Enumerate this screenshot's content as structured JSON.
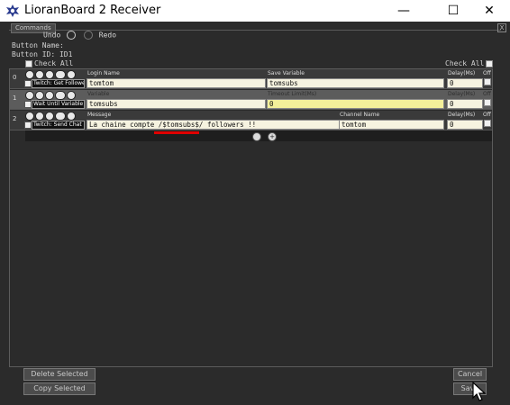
{
  "window": {
    "title": "LioranBoard 2 Receiver",
    "minimize_glyph": "—",
    "maximize_glyph": "☐",
    "close_glyph": "✕",
    "app_icon": "lioranboard-logo-icon"
  },
  "panel": {
    "tab_label": "Commands",
    "close_glyph": "X",
    "undo_label": "Undo",
    "redo_label": "Redo",
    "button_name_line": "Button Name:",
    "button_id_line": "Button ID: ID1",
    "check_all_label": "Check All"
  },
  "rows": [
    {
      "index": "0",
      "command": "Twitch: Get Follower",
      "field1_label": "Login Name",
      "field1_value": "tomtom",
      "field2_label": "Save Variable",
      "field2_value": "tomsubs",
      "delay_label": "Delay(Ms)",
      "delay_value": "0",
      "off_label": "Off"
    },
    {
      "index": "1",
      "command": "Wait Until Variable Exists",
      "field1_label": "Variable",
      "field1_value": "tomsubs",
      "field2_label": "Timeout Limit(Ms)",
      "field2_value": "0",
      "delay_label": "Delay(Ms)",
      "delay_value": "0",
      "off_label": "Off"
    },
    {
      "index": "2",
      "command": "Twitch: Send Chat Message",
      "field1_label": "Message",
      "field1_value": "La chaine compte /$tomsubs$/ followers !!",
      "field2_label": "Channel Name",
      "field2_value": "tomtom",
      "delay_label": "Delay(Ms)",
      "delay_value": "0",
      "off_label": "Off"
    }
  ],
  "buttons": {
    "delete_selected": "Delete Selected",
    "copy_selected": "Copy Selected",
    "cancel": "Cancel",
    "save": "Save"
  },
  "colors": {
    "highlight_underline": "#e00000",
    "input_bg": "#f6f3e0",
    "input_yellow": "#f3ef9a"
  }
}
